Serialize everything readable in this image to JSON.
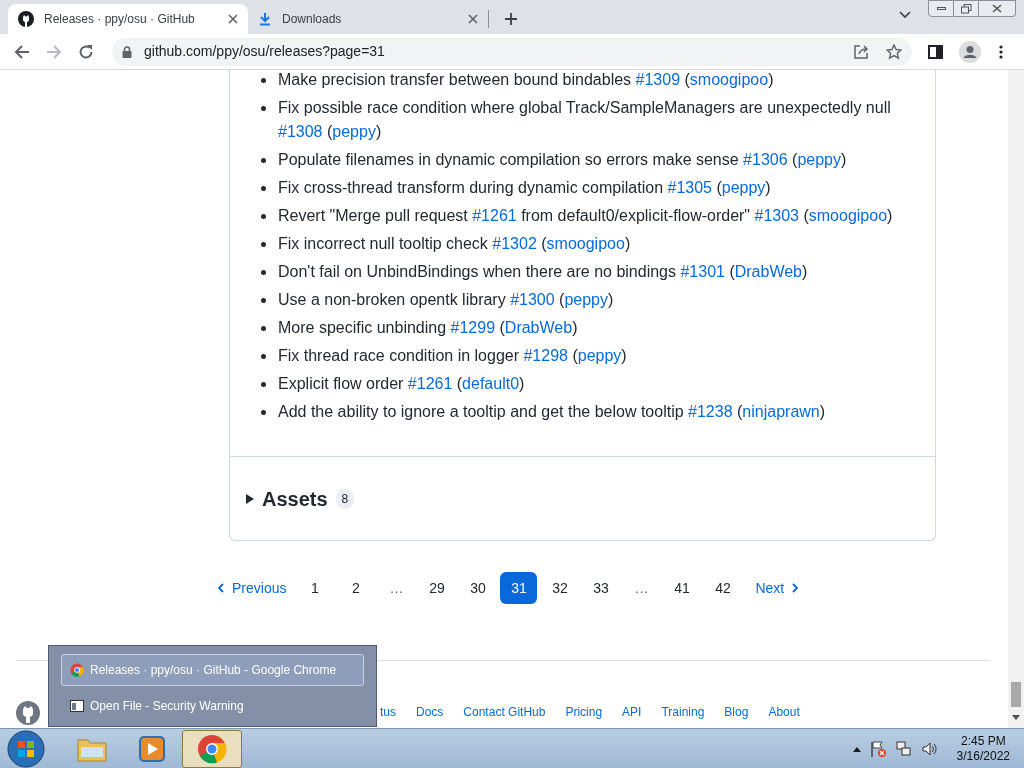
{
  "browser": {
    "tabs": [
      {
        "title": "Releases · ppy/osu · GitHub",
        "selected": true
      },
      {
        "title": "Downloads",
        "selected": false
      }
    ],
    "address": "github.com/ppy/osu/releases?page=31"
  },
  "release": {
    "items": [
      [
        {
          "kind": "text",
          "text": "Make precision transfer between bound bindables "
        },
        {
          "kind": "link",
          "text": "#1309"
        },
        {
          "kind": "text",
          "text": " ("
        },
        {
          "kind": "link",
          "text": "smoogipoo"
        },
        {
          "kind": "text",
          "text": ")"
        }
      ],
      [
        {
          "kind": "text",
          "text": "Fix possible race condition where global Track/SampleManagers are unexpectedly null "
        },
        {
          "kind": "link",
          "text": "#1308"
        },
        {
          "kind": "text",
          "text": " ("
        },
        {
          "kind": "link",
          "text": "peppy"
        },
        {
          "kind": "text",
          "text": ")"
        }
      ],
      [
        {
          "kind": "text",
          "text": "Populate filenames in dynamic compilation so errors make sense "
        },
        {
          "kind": "link",
          "text": "#1306"
        },
        {
          "kind": "text",
          "text": " ("
        },
        {
          "kind": "link",
          "text": "peppy"
        },
        {
          "kind": "text",
          "text": ")"
        }
      ],
      [
        {
          "kind": "text",
          "text": "Fix cross-thread transform during dynamic compilation "
        },
        {
          "kind": "link",
          "text": "#1305"
        },
        {
          "kind": "text",
          "text": " ("
        },
        {
          "kind": "link",
          "text": "peppy"
        },
        {
          "kind": "text",
          "text": ")"
        }
      ],
      [
        {
          "kind": "text",
          "text": "Revert \"Merge pull request "
        },
        {
          "kind": "link",
          "text": "#1261"
        },
        {
          "kind": "text",
          "text": " from default0/explicit-flow-order\" "
        },
        {
          "kind": "link",
          "text": "#1303"
        },
        {
          "kind": "text",
          "text": " ("
        },
        {
          "kind": "link",
          "text": "smoogipoo"
        },
        {
          "kind": "text",
          "text": ")"
        }
      ],
      [
        {
          "kind": "text",
          "text": "Fix incorrect null tooltip check "
        },
        {
          "kind": "link",
          "text": "#1302"
        },
        {
          "kind": "text",
          "text": " ("
        },
        {
          "kind": "link",
          "text": "smoogipoo"
        },
        {
          "kind": "text",
          "text": ")"
        }
      ],
      [
        {
          "kind": "text",
          "text": "Don't fail on UnbindBindings when there are no bindings "
        },
        {
          "kind": "link",
          "text": "#1301"
        },
        {
          "kind": "text",
          "text": " ("
        },
        {
          "kind": "link",
          "text": "DrabWeb"
        },
        {
          "kind": "text",
          "text": ")"
        }
      ],
      [
        {
          "kind": "text",
          "text": "Use a non-broken opentk library "
        },
        {
          "kind": "link",
          "text": "#1300"
        },
        {
          "kind": "text",
          "text": " ("
        },
        {
          "kind": "link",
          "text": "peppy"
        },
        {
          "kind": "text",
          "text": ")"
        }
      ],
      [
        {
          "kind": "text",
          "text": "More specific unbinding "
        },
        {
          "kind": "link",
          "text": "#1299"
        },
        {
          "kind": "text",
          "text": " ("
        },
        {
          "kind": "link",
          "text": "DrabWeb"
        },
        {
          "kind": "text",
          "text": ")"
        }
      ],
      [
        {
          "kind": "text",
          "text": "Fix thread race condition in logger "
        },
        {
          "kind": "link",
          "text": "#1298"
        },
        {
          "kind": "text",
          "text": " ("
        },
        {
          "kind": "link",
          "text": "peppy"
        },
        {
          "kind": "text",
          "text": ")"
        }
      ],
      [
        {
          "kind": "text",
          "text": "Explicit flow order "
        },
        {
          "kind": "link",
          "text": "#1261"
        },
        {
          "kind": "text",
          "text": " ("
        },
        {
          "kind": "link",
          "text": "default0"
        },
        {
          "kind": "text",
          "text": ")"
        }
      ],
      [
        {
          "kind": "text",
          "text": "Add the ability to ignore a tooltip and get the below tooltip "
        },
        {
          "kind": "link",
          "text": "#1238"
        },
        {
          "kind": "text",
          "text": " ("
        },
        {
          "kind": "link",
          "text": "ninjaprawn"
        },
        {
          "kind": "text",
          "text": ")"
        }
      ]
    ],
    "assets": {
      "label": "Assets",
      "count": "8",
      "expanded": false
    }
  },
  "pagination": {
    "previous": "Previous",
    "next": "Next",
    "pages": [
      {
        "label": "1",
        "kind": "page",
        "selected": false
      },
      {
        "label": "2",
        "kind": "page",
        "selected": false
      },
      {
        "label": "…",
        "kind": "gap"
      },
      {
        "label": "29",
        "kind": "page",
        "selected": false
      },
      {
        "label": "30",
        "kind": "page",
        "selected": false
      },
      {
        "label": "31",
        "kind": "page",
        "selected": true
      },
      {
        "label": "32",
        "kind": "page",
        "selected": false
      },
      {
        "label": "33",
        "kind": "page",
        "selected": false
      },
      {
        "label": "…",
        "kind": "gap"
      },
      {
        "label": "41",
        "kind": "page",
        "selected": false
      },
      {
        "label": "42",
        "kind": "page",
        "selected": false
      }
    ]
  },
  "footer": {
    "links": [
      "tus",
      "Docs",
      "Contact GitHub",
      "Pricing",
      "API",
      "Training",
      "Blog",
      "About"
    ]
  },
  "thumbnail_list": [
    {
      "title": "Releases · ppy/osu · GitHub - Google Chrome",
      "kind": "chrome",
      "selected": true
    },
    {
      "title": "Open File - Security Warning",
      "kind": "dialog",
      "selected": false
    }
  ],
  "taskbar": {
    "apps": [
      {
        "kind": "explorer",
        "selected": false
      },
      {
        "kind": "media",
        "selected": false
      },
      {
        "kind": "chrome",
        "selected": true
      }
    ],
    "clock": {
      "time": "2:45 PM",
      "date": "3/16/2022"
    }
  }
}
